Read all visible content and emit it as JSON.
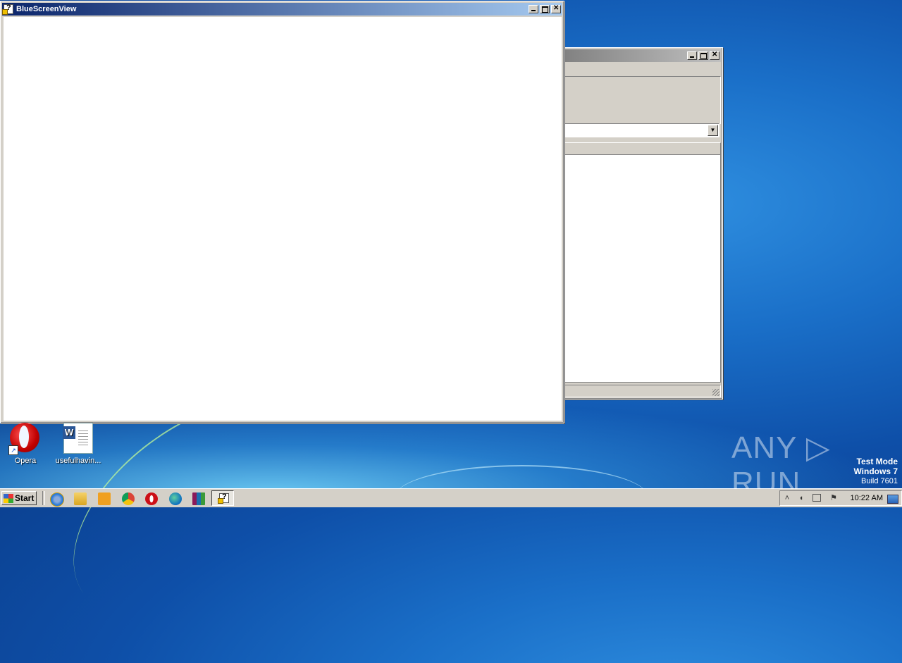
{
  "windows": {
    "main": {
      "title": "BlueScreenView"
    },
    "background": {
      "title": ""
    }
  },
  "desktop": {
    "icons": [
      {
        "label": "Opera",
        "icon": "opera-icon"
      },
      {
        "label": "usefulhavin...",
        "icon": "word-document-icon"
      }
    ]
  },
  "watermark": {
    "text": "ANY ▷ RUN"
  },
  "system_info": {
    "line1": "Test Mode",
    "line2": "Windows 7",
    "line3": "Build 7601"
  },
  "taskbar": {
    "start_label": "Start",
    "pinned": [
      "internet-explorer-icon",
      "file-explorer-icon",
      "media-player-icon",
      "chrome-icon",
      "opera-icon",
      "edge-icon",
      "winrar-icon"
    ],
    "active_task": "bluescreenview-icon",
    "clock": "10:22 AM"
  },
  "colors": {
    "active_title_start": "#0a246a",
    "active_title_end": "#a6caf0",
    "chrome": "#d4d0c8"
  }
}
